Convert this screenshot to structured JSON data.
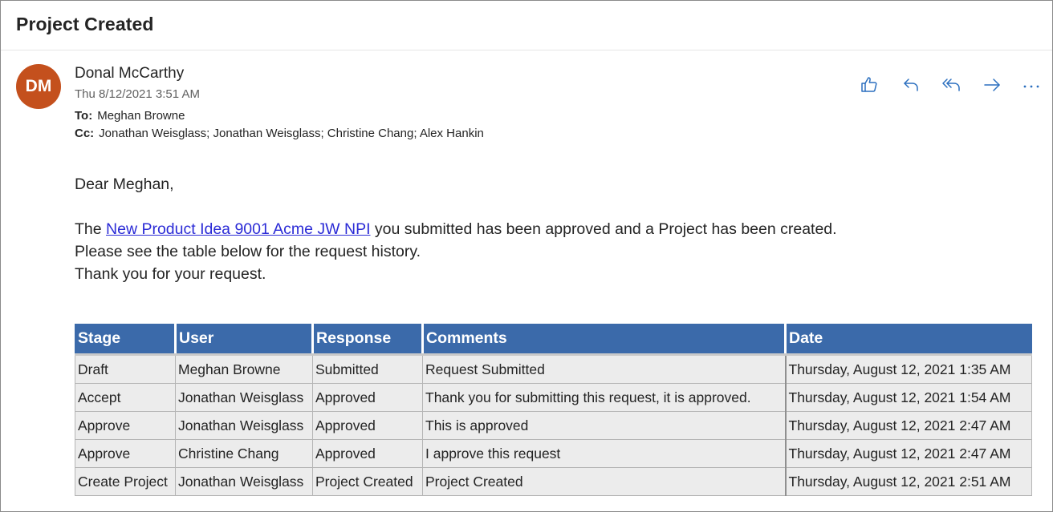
{
  "subject": "Project Created",
  "sender": {
    "initials": "DM",
    "name": "Donal McCarthy",
    "date": "Thu 8/12/2021 3:51 AM",
    "avatar_color": "#c4501d"
  },
  "recipients": {
    "to_label": "To:",
    "to": "Meghan Browne",
    "cc_label": "Cc:",
    "cc": "Jonathan Weisglass; Jonathan Weisglass; Christine Chang; Alex Hankin"
  },
  "actions": [
    {
      "name": "like-icon"
    },
    {
      "name": "reply-icon"
    },
    {
      "name": "reply-all-icon"
    },
    {
      "name": "forward-icon"
    },
    {
      "name": "more-icon"
    }
  ],
  "body": {
    "greeting": "Dear Meghan,",
    "line1_prefix": "The ",
    "link_text": "New Product Idea 9001 Acme JW NPI",
    "line1_suffix": " you submitted has been approved and a Project has been created.",
    "line2": "Please see the table below for the request history.",
    "line3": "Thank you for your request."
  },
  "table": {
    "headers": [
      "Stage",
      "User",
      "Response",
      "Comments",
      "Date"
    ],
    "header_color": "#3b6aaa",
    "rows": [
      [
        "Draft",
        "Meghan Browne",
        "Submitted",
        "Request Submitted",
        "Thursday, August 12, 2021 1:35 AM"
      ],
      [
        "Accept",
        "Jonathan Weisglass",
        "Approved",
        "Thank you for submitting this request, it is approved.",
        "Thursday, August 12, 2021 1:54 AM"
      ],
      [
        "Approve",
        "Jonathan Weisglass",
        "Approved",
        "This is approved",
        "Thursday, August 12, 2021 2:47 AM"
      ],
      [
        "Approve",
        "Christine Chang",
        "Approved",
        "I approve this request",
        "Thursday, August 12, 2021 2:47 AM"
      ],
      [
        "Create Project",
        "Jonathan Weisglass",
        "Project Created",
        "Project Created",
        "Thursday, August 12, 2021 2:51 AM"
      ]
    ]
  },
  "accent_color": "#2b6fbf"
}
